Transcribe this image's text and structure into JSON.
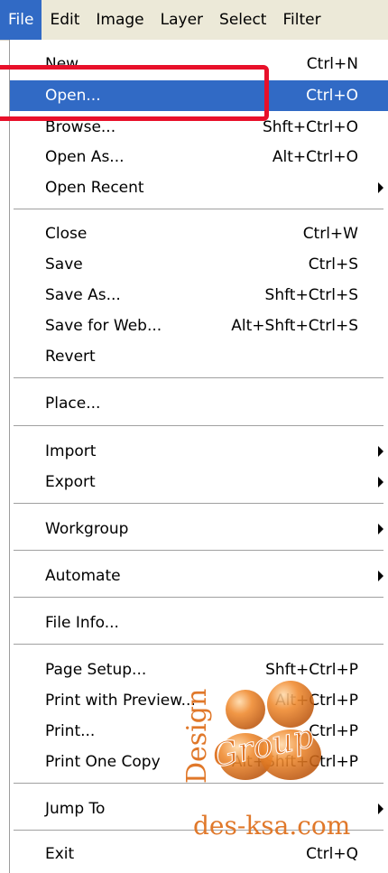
{
  "menubar": {
    "items": [
      {
        "label": "File",
        "active": true
      },
      {
        "label": "Edit"
      },
      {
        "label": "Image"
      },
      {
        "label": "Layer"
      },
      {
        "label": "Select"
      },
      {
        "label": "Filter"
      }
    ]
  },
  "menu": {
    "items": [
      {
        "label": "New...",
        "shortcut": "Ctrl+N"
      },
      {
        "label": "Open...",
        "shortcut": "Ctrl+O",
        "highlighted": true
      },
      {
        "label": "Browse...",
        "shortcut": "Shft+Ctrl+O"
      },
      {
        "label": "Open As...",
        "shortcut": "Alt+Ctrl+O"
      },
      {
        "label": "Open Recent",
        "submenu": true
      },
      {
        "label": "Close",
        "shortcut": "Ctrl+W"
      },
      {
        "label": "Save",
        "shortcut": "Ctrl+S"
      },
      {
        "label": "Save As...",
        "shortcut": "Shft+Ctrl+S"
      },
      {
        "label": "Save for Web...",
        "shortcut": "Alt+Shft+Ctrl+S"
      },
      {
        "label": "Revert",
        "shortcut": ""
      },
      {
        "label": "Place...",
        "shortcut": ""
      },
      {
        "label": "Import",
        "submenu": true
      },
      {
        "label": "Export",
        "submenu": true
      },
      {
        "label": "Workgroup",
        "submenu": true
      },
      {
        "label": "Automate",
        "submenu": true
      },
      {
        "label": "File Info...",
        "shortcut": ""
      },
      {
        "label": "Page Setup...",
        "shortcut": "Shft+Ctrl+P"
      },
      {
        "label": "Print with Preview...",
        "shortcut": "Alt+Ctrl+P"
      },
      {
        "label": "Print...",
        "shortcut": "Ctrl+P"
      },
      {
        "label": "Print One Copy",
        "shortcut": "Alt+Shft+Ctrl+P"
      },
      {
        "label": "Jump To",
        "submenu": true
      },
      {
        "label": "Exit",
        "shortcut": "Ctrl+Q"
      }
    ]
  },
  "watermark": {
    "left_text": "Design",
    "script_text": "Group",
    "url_text": "des-ksa.com",
    "color": "#e0782a"
  },
  "colors": {
    "highlight": "#316ac5",
    "annotation": "#e8102a"
  }
}
